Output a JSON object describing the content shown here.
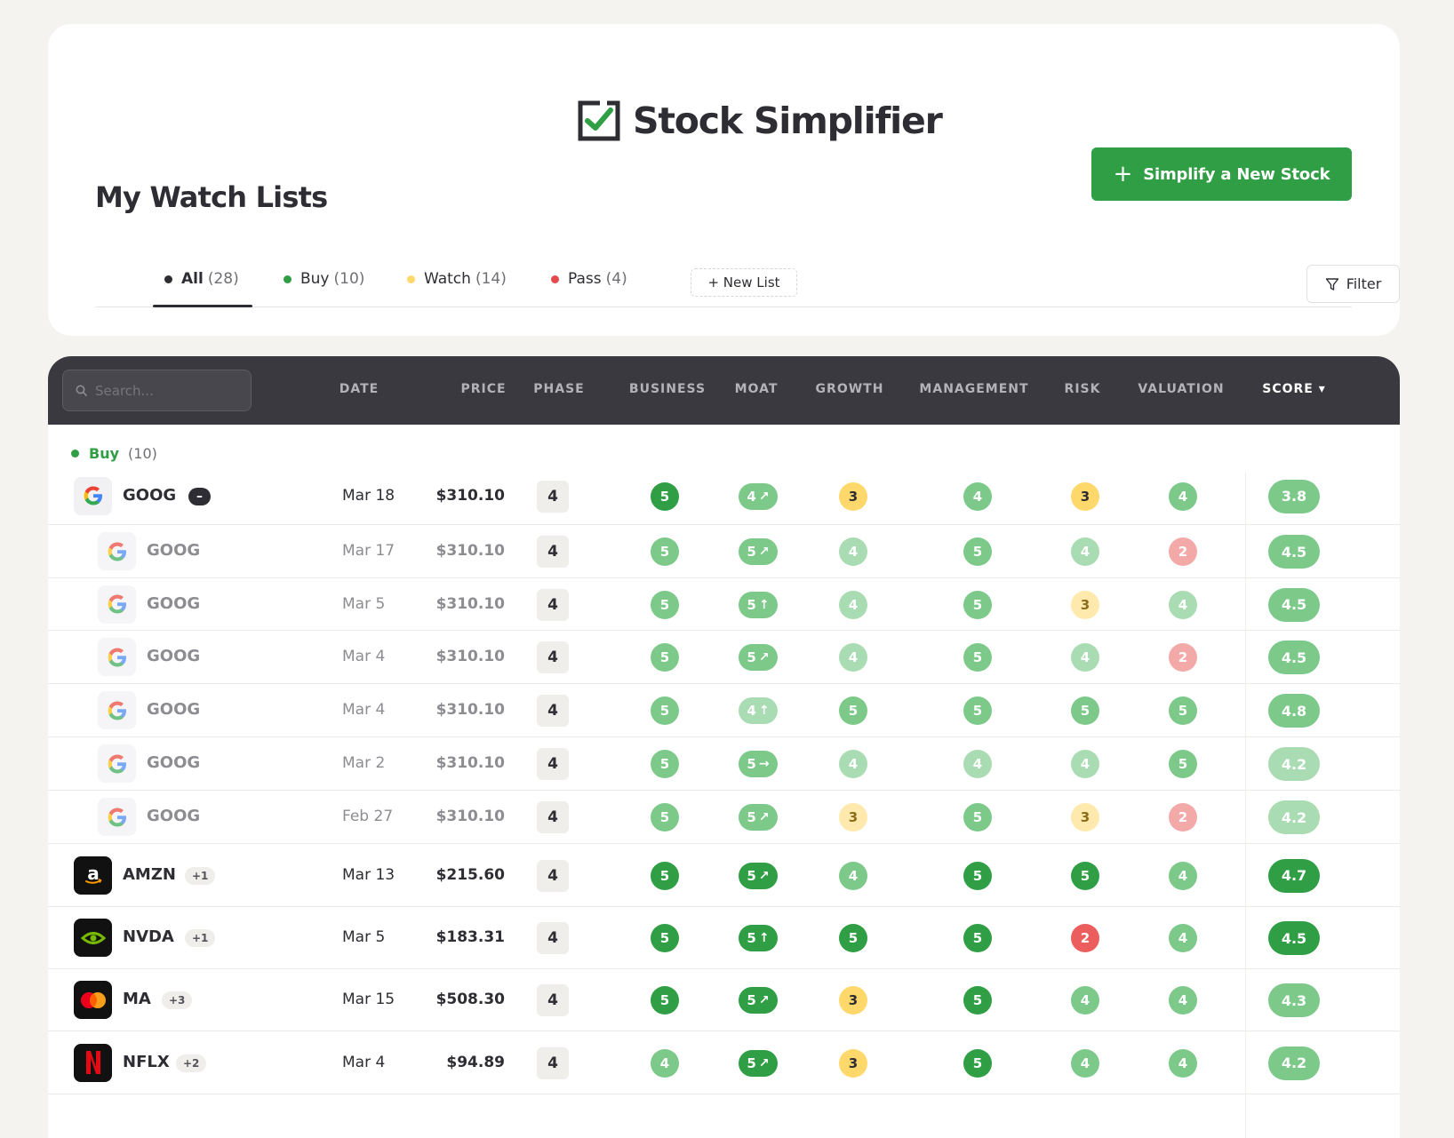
{
  "app": {
    "name": "Stock Simplifier"
  },
  "page": {
    "title": "My Watch Lists"
  },
  "actions": {
    "new_stock": "Simplify a New Stock",
    "new_list": "+ New List",
    "filter": "Filter"
  },
  "tabs": [
    {
      "label": "All",
      "count": "(28)",
      "dot_color": "#2e2d33",
      "active": true
    },
    {
      "label": "Buy",
      "count": "(10)",
      "dot_color": "#2f9e44",
      "active": false
    },
    {
      "label": "Watch",
      "count": "(14)",
      "dot_color": "#ffd86b",
      "active": false
    },
    {
      "label": "Pass",
      "count": "(4)",
      "dot_color": "#e5484d",
      "active": false
    }
  ],
  "search": {
    "placeholder": "Search..."
  },
  "columns": [
    "DATE",
    "PRICE",
    "PHASE",
    "BUSINESS",
    "MOAT",
    "GROWTH",
    "MANAGEMENT",
    "RISK",
    "VALUATION",
    "SCORE ▾"
  ],
  "group": {
    "label": "Buy",
    "count": "(10)"
  },
  "colors": {
    "green_dark": "#2f9e44",
    "green_mid": "#7cc98a",
    "green_light": "#a9dcb2",
    "yellow": "#ffd86b",
    "yellow_light": "#ffe9ad",
    "red": "#ec5d5d",
    "red_light": "#f4a9a9"
  },
  "rows": [
    {
      "ticker": "GOOG",
      "logo": "google",
      "badge": "–",
      "badge_type": "collapse",
      "date": "Mar 18",
      "price": "$310.10",
      "phase": "4",
      "business": "5",
      "moat": "4",
      "moat_arrow": "↗",
      "growth": "3",
      "management": "4",
      "risk": "3",
      "valuation": "4",
      "score": "3.8",
      "sub": false
    },
    {
      "ticker": "GOOG",
      "logo": "google",
      "date": "Mar 17",
      "price": "$310.10",
      "phase": "4",
      "business": "5",
      "moat": "5",
      "moat_arrow": "↗",
      "growth": "4",
      "management": "5",
      "risk": "4",
      "valuation": "2",
      "score": "4.5",
      "sub": true
    },
    {
      "ticker": "GOOG",
      "logo": "google",
      "date": "Mar 5",
      "price": "$310.10",
      "phase": "4",
      "business": "5",
      "moat": "5",
      "moat_arrow": "↑",
      "growth": "4",
      "management": "5",
      "risk": "3",
      "valuation": "4",
      "score": "4.5",
      "sub": true
    },
    {
      "ticker": "GOOG",
      "logo": "google",
      "date": "Mar 4",
      "price": "$310.10",
      "phase": "4",
      "business": "5",
      "moat": "5",
      "moat_arrow": "↗",
      "growth": "4",
      "management": "5",
      "risk": "4",
      "valuation": "2",
      "score": "4.5",
      "sub": true
    },
    {
      "ticker": "GOOG",
      "logo": "google",
      "date": "Mar 4",
      "price": "$310.10",
      "phase": "4",
      "business": "5",
      "moat": "4",
      "moat_arrow": "↑",
      "growth": "5",
      "management": "5",
      "risk": "5",
      "valuation": "5",
      "score": "4.8",
      "sub": true
    },
    {
      "ticker": "GOOG",
      "logo": "google",
      "date": "Mar 2",
      "price": "$310.10",
      "phase": "4",
      "business": "5",
      "moat": "5",
      "moat_arrow": "→",
      "growth": "4",
      "management": "4",
      "risk": "4",
      "valuation": "5",
      "score": "4.2",
      "sub": true
    },
    {
      "ticker": "GOOG",
      "logo": "google",
      "date": "Feb 27",
      "price": "$310.10",
      "phase": "4",
      "business": "5",
      "moat": "5",
      "moat_arrow": "↗",
      "growth": "3",
      "management": "5",
      "risk": "3",
      "valuation": "2",
      "score": "4.2",
      "sub": true
    },
    {
      "ticker": "AMZN",
      "logo": "amazon",
      "badge": "+1",
      "badge_type": "count",
      "date": "Mar 13",
      "price": "$215.60",
      "phase": "4",
      "business": "5",
      "moat": "5",
      "moat_arrow": "↗",
      "growth": "4",
      "management": "5",
      "risk": "5",
      "valuation": "4",
      "score": "4.7",
      "sub": false
    },
    {
      "ticker": "NVDA",
      "logo": "nvidia",
      "badge": "+1",
      "badge_type": "count",
      "date": "Mar 5",
      "price": "$183.31",
      "phase": "4",
      "business": "5",
      "moat": "5",
      "moat_arrow": "↑",
      "growth": "5",
      "management": "5",
      "risk": "2",
      "valuation": "4",
      "score": "4.5",
      "sub": false
    },
    {
      "ticker": "MA",
      "logo": "mastercard",
      "badge": "+3",
      "badge_type": "count",
      "date": "Mar 15",
      "price": "$508.30",
      "phase": "4",
      "business": "5",
      "moat": "5",
      "moat_arrow": "↗",
      "growth": "3",
      "management": "5",
      "risk": "4",
      "valuation": "4",
      "score": "4.3",
      "sub": false
    },
    {
      "ticker": "NFLX",
      "logo": "netflix",
      "badge": "+2",
      "badge_type": "count",
      "date": "Mar 4",
      "price": "$94.89",
      "phase": "4",
      "business": "4",
      "moat": "5",
      "moat_arrow": "↗",
      "growth": "3",
      "management": "5",
      "risk": "4",
      "valuation": "4",
      "score": "4.2",
      "sub": false
    }
  ]
}
